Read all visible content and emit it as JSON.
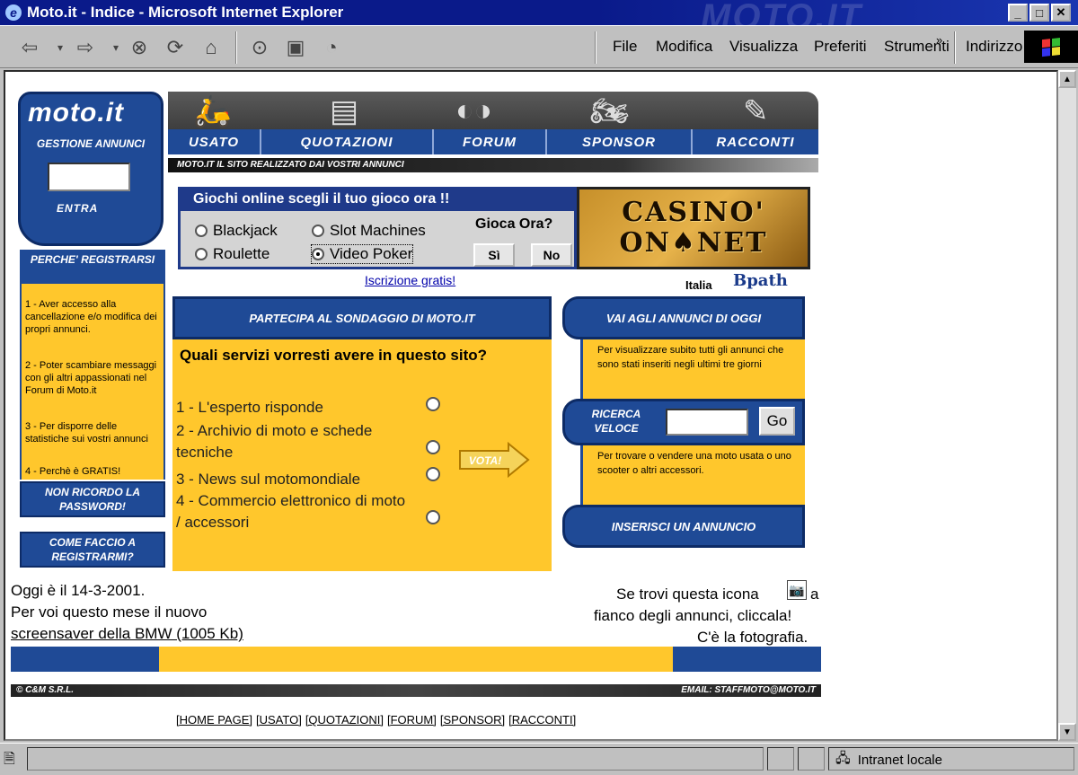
{
  "window": {
    "title": "Moto.it - Indice - Microsoft Internet Explorer",
    "watermark": "MOTO.IT",
    "buttons": {
      "minimize": "_",
      "maximize": "□",
      "close": "✕"
    }
  },
  "menu": {
    "items": [
      "File",
      "Modifica",
      "Visualizza",
      "Preferiti",
      "Strumenti"
    ],
    "more": "»",
    "address_label": "Indirizzo"
  },
  "site": {
    "logo": "moto.it",
    "gestione": "GESTIONE ANNUNCI",
    "entra": "ENTRA",
    "nav": [
      "USATO",
      "QUOTAZIONI",
      "FORUM",
      "SPONSOR",
      "RACCONTI"
    ],
    "tagline": "MOTO.IT IL SITO REALIZZATO DAI VOSTRI ANNUNCI"
  },
  "games": {
    "title": "Giochi online scegli il tuo gioco ora !!",
    "options": [
      "Blackjack",
      "Slot Machines",
      "Roulette",
      "Video Poker"
    ],
    "selected": "Video Poker",
    "gioca": "Gioca Ora?",
    "si": "Sì",
    "no": "No",
    "casino_line1": "CASINO'",
    "casino_line2": "ON♠NET",
    "iscrizione": "Iscrizione gratis!",
    "italia": "Italia",
    "bpath": "Bpath"
  },
  "left": {
    "perche_title": "PERCHE' REGISTRARSI",
    "items": [
      "1 - Aver accesso alla cancellazione e/o modifica dei propri annunci.",
      "2 - Poter scambiare messaggi con gli altri appassionati nel Forum di Moto.it",
      "3 - Per disporre delle statistiche sui vostri annunci",
      "4 - Perchè è GRATIS!"
    ],
    "password": "NON RICORDO LA PASSWORD!",
    "come": "COME FACCIO A REGISTRARMI?"
  },
  "poll": {
    "header": "PARTECIPA AL SONDAGGIO DI MOTO.IT",
    "question": "Quali servizi vorresti avere in questo sito?",
    "options": [
      "1 - L'esperto risponde",
      "2 - Archivio di moto e schede tecniche",
      "3 - News sul motomondiale",
      "4 - Commercio elettronico di moto / accessori"
    ],
    "vota": "VOTA!"
  },
  "right": {
    "annunci_oggi": "VAI AGLI ANNUNCI DI OGGI",
    "annunci_desc": "Per visualizzare subito tutti gli annunci che sono stati inseriti negli ultimi tre giorni",
    "ricerca": "RICERCA VELOCE",
    "go": "Go",
    "ricerca_desc": "Per trovare o vendere una moto usata o uno scooter o altri accessori.",
    "inserisci": "INSERISCI UN ANNUNCIO"
  },
  "bottom": {
    "date_line": "Oggi è il 14-3-2001.",
    "mese_line": "Per voi questo mese il nuovo",
    "bmw_link": "screensaver della BMW (1005 Kb)",
    "icona_line1": "Se trovi questa icona",
    "icona_line1b": "a",
    "icona_line2": "fianco degli annunci, cliccala!",
    "icona_line3": "C'è la fotografia.",
    "copyright": "© C&M S.R.L.",
    "email": "EMAIL: STAFFMOTO@MOTO.IT",
    "links": [
      "[HOME PAGE]",
      "[USATO]",
      "[QUOTAZIONI]",
      "[FORUM]",
      "[SPONSOR]",
      "[RACCONTI]"
    ]
  },
  "status": {
    "zone": "Intranet locale"
  },
  "colors": {
    "blue": "#1f4a96",
    "yellow": "#ffc72c"
  }
}
